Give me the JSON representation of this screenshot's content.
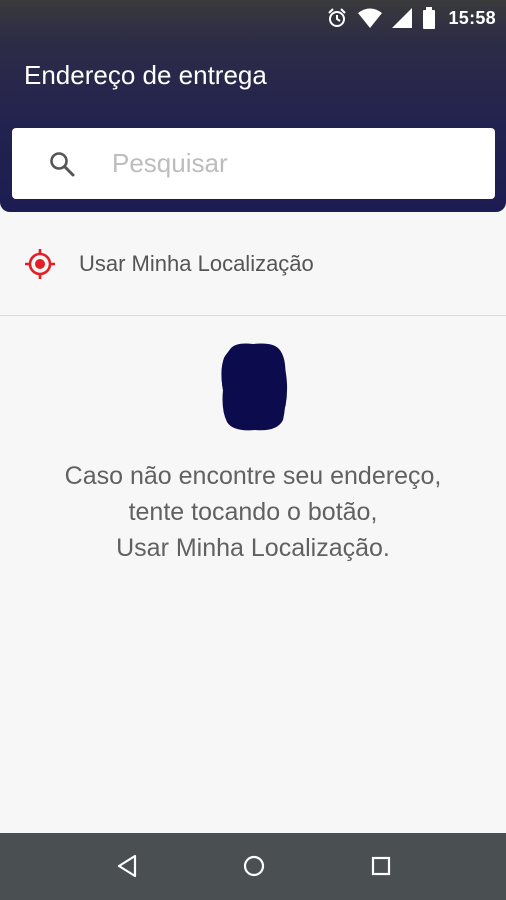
{
  "status_bar": {
    "time": "15:58",
    "icons": [
      "alarm-clock-icon",
      "wifi-icon",
      "cellular-signal-icon",
      "battery-icon"
    ]
  },
  "header": {
    "title": "Endereço de entrega"
  },
  "search": {
    "icon": "search-icon",
    "placeholder": "Pesquisar",
    "value": ""
  },
  "location": {
    "icon": "location-target-icon",
    "label": "Usar Minha Localização",
    "icon_color": "#e31e24"
  },
  "empty_state": {
    "illustration": "redacted-illustration",
    "lines": [
      "Caso não encontre seu endereço,",
      "tente tocando o botão,",
      "Usar Minha Localização."
    ]
  },
  "nav_bar": {
    "buttons": [
      "back-icon",
      "home-icon",
      "recents-icon"
    ]
  },
  "colors": {
    "header_dark": "#1c1c52",
    "accent_red": "#e31e24",
    "background": "#f7f7f7",
    "nav_bar": "#4a4f52"
  }
}
